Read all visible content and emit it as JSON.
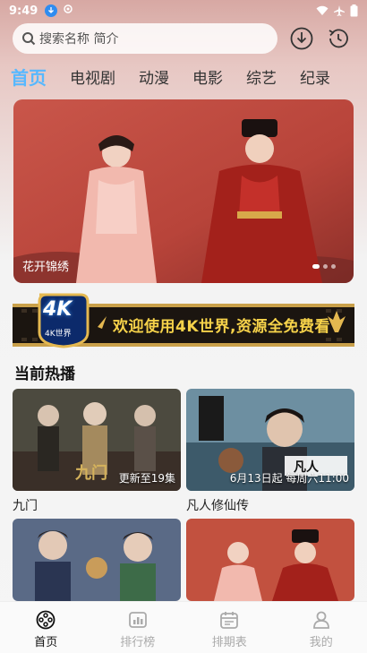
{
  "status_bar": {
    "time": "9:49"
  },
  "search": {
    "placeholder": "搜索名称 简介"
  },
  "header_icons": [
    "download-icon",
    "history-icon"
  ],
  "tabs": [
    {
      "label": "首页",
      "active": true
    },
    {
      "label": "电视剧",
      "active": false
    },
    {
      "label": "动漫",
      "active": false
    },
    {
      "label": "电影",
      "active": false
    },
    {
      "label": "综艺",
      "active": false
    },
    {
      "label": "纪录",
      "active": false
    }
  ],
  "banner": {
    "title": "花开锦绣"
  },
  "promo": {
    "badge_text": "4K",
    "badge_caption": "4K世界",
    "message": "欢迎使用4K世界,资源全免费看"
  },
  "section": {
    "title": "当前热播"
  },
  "cards": [
    {
      "name": "九门",
      "tag": "更新至19集"
    },
    {
      "name": "凡人修仙传",
      "tag": "6月13日起 每周六11:00"
    },
    {
      "name": "",
      "tag": ""
    },
    {
      "name": "",
      "tag": ""
    }
  ],
  "bottom_nav": [
    {
      "label": "首页",
      "icon": "film-reel-icon",
      "active": true
    },
    {
      "label": "排行榜",
      "icon": "ranking-icon",
      "active": false
    },
    {
      "label": "排期表",
      "icon": "calendar-icon",
      "active": false
    },
    {
      "label": "我的",
      "icon": "profile-icon",
      "active": false
    }
  ],
  "colors": {
    "accent": "#57b8ff",
    "promo_gold": "#f6d24a"
  }
}
